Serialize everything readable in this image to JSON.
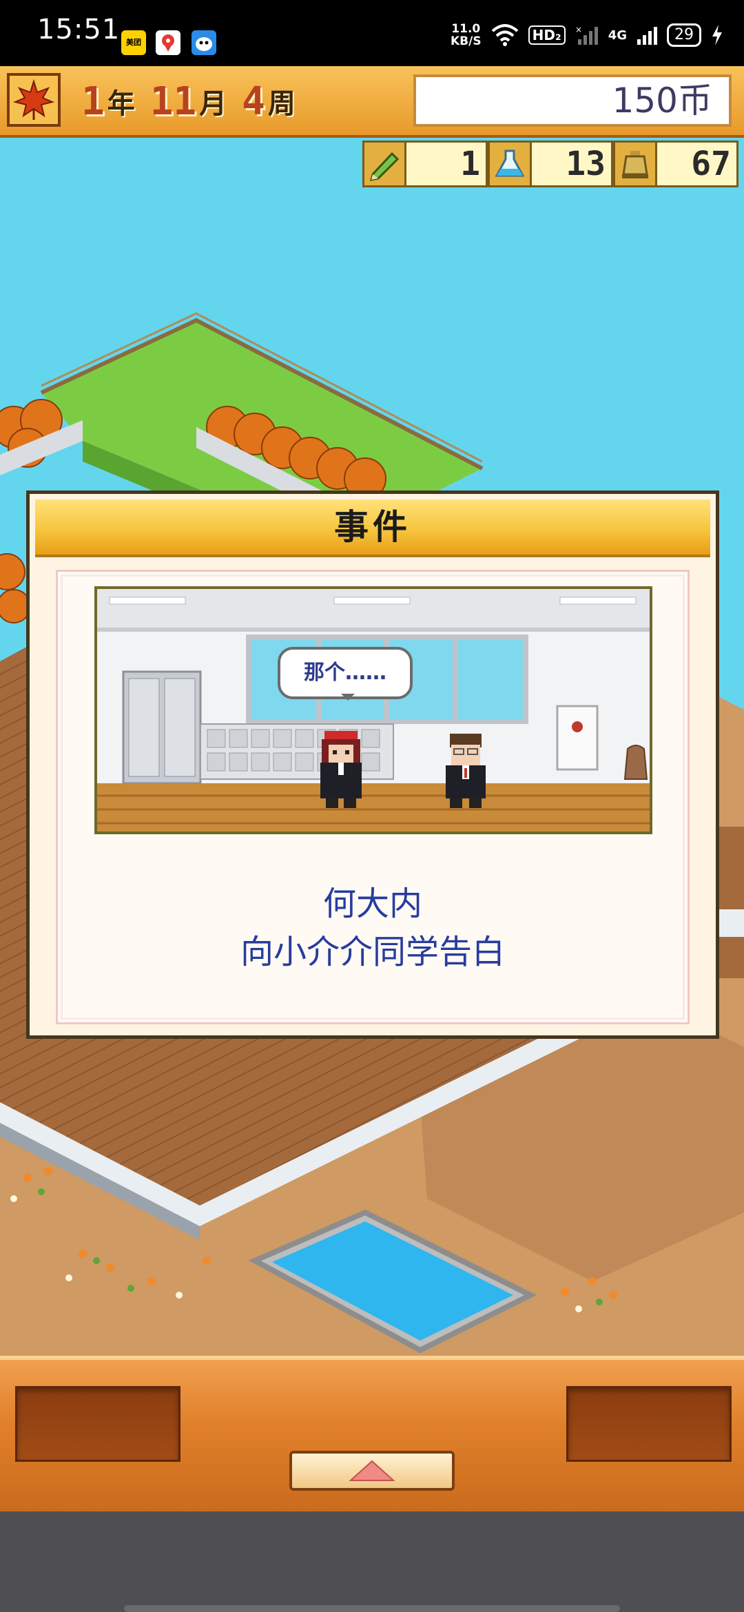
{
  "status_bar": {
    "time": "15:51",
    "app_badge": "美团",
    "net_speed_value": "11.0",
    "net_speed_unit": "KB/S",
    "hd_badge": "HD₂",
    "net_type": "4G",
    "battery": "29"
  },
  "header": {
    "year_num": "1",
    "year_unit": "年",
    "month_num": "11",
    "month_unit": "月",
    "week_num": "4",
    "week_unit": "周",
    "money": "150币"
  },
  "resources": [
    {
      "icon": "pencil-icon",
      "value": "1"
    },
    {
      "icon": "flask-icon",
      "value": "13"
    },
    {
      "icon": "bell-icon",
      "value": "67"
    }
  ],
  "event_dialog": {
    "title": "事件",
    "speech_bubble": "那个……",
    "line1": "何大内",
    "line2": "向小介介同学告白"
  },
  "colors": {
    "title_gold": "#f7c53f",
    "money_text": "#3f3a62",
    "event_text": "#273c9e",
    "sky": "#63d6ee",
    "panel_orange": "#e1812b"
  }
}
